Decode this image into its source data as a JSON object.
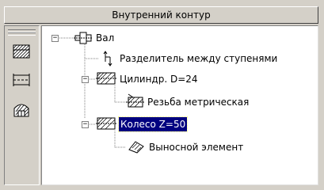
{
  "panel": {
    "title": "Внутренний контур"
  },
  "toolbar": {
    "buttons": [
      {
        "icon": "hatched-section-icon"
      },
      {
        "icon": "dimension-section-icon"
      },
      {
        "icon": "hatched-gear-icon"
      }
    ]
  },
  "tree": {
    "nodes": [
      {
        "label": "Вал",
        "icon": "shaft-icon",
        "expanded": true,
        "selected": false
      },
      {
        "label": "Разделитель между ступенями",
        "icon": "step-divider-icon",
        "expanded": null,
        "selected": false
      },
      {
        "label": "Цилиндр. D=24",
        "icon": "cylinder-icon",
        "expanded": true,
        "selected": false
      },
      {
        "label": "Резьба метрическая",
        "icon": "thread-icon",
        "expanded": null,
        "selected": false
      },
      {
        "label": "Колесо Z=50",
        "icon": "gear-wheel-icon",
        "expanded": true,
        "selected": true
      },
      {
        "label": "Выносной элемент",
        "icon": "detail-element-icon",
        "expanded": null,
        "selected": false
      }
    ]
  },
  "colors": {
    "selection_bg": "#000080",
    "selection_fg": "#ffffff",
    "window_bg": "#d4d0c8"
  }
}
